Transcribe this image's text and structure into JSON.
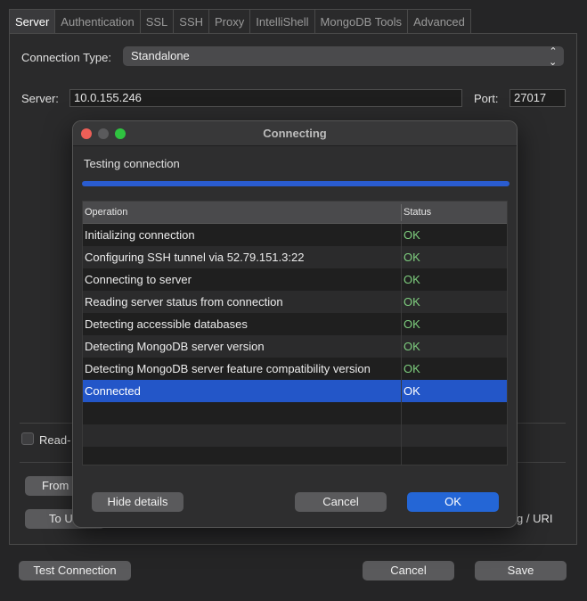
{
  "tabs": [
    {
      "label": "Server",
      "active": true
    },
    {
      "label": "Authentication"
    },
    {
      "label": "SSL"
    },
    {
      "label": "SSH"
    },
    {
      "label": "Proxy"
    },
    {
      "label": "IntelliShell"
    },
    {
      "label": "MongoDB Tools"
    },
    {
      "label": "Advanced"
    }
  ],
  "form": {
    "connection_type_label": "Connection Type:",
    "connection_type_value": "Standalone",
    "server_label": "Server:",
    "server_value": "10.0.155.246",
    "port_label": "Port:",
    "port_value": "27017",
    "readonly_label_partial": "Read-",
    "from_button_partial": "From",
    "to_button_partial": "To U",
    "uri_partial": "g / URI"
  },
  "footer": {
    "test_connection": "Test Connection",
    "cancel": "Cancel",
    "save": "Save"
  },
  "dialog": {
    "title": "Connecting",
    "status_text": "Testing connection",
    "progress": 1.0,
    "columns": {
      "operation": "Operation",
      "status": "Status"
    },
    "rows": [
      {
        "operation": "Initializing connection",
        "status": "OK"
      },
      {
        "operation": "Configuring SSH tunnel via 52.79.151.3:22",
        "status": "OK"
      },
      {
        "operation": "Connecting to server",
        "status": "OK"
      },
      {
        "operation": "Reading server status from connection",
        "status": "OK"
      },
      {
        "operation": "Detecting accessible databases",
        "status": "OK"
      },
      {
        "operation": "Detecting MongoDB server version",
        "status": "OK"
      },
      {
        "operation": "Detecting MongoDB server feature compatibility version",
        "status": "OK"
      },
      {
        "operation": "Connected",
        "status": "OK",
        "selected": true
      }
    ],
    "hide_details": "Hide details",
    "cancel": "Cancel",
    "ok": "OK"
  },
  "colors": {
    "accent": "#2466d6",
    "selection": "#2356c8",
    "ok_green": "#7fcf7f",
    "close_light": "#ed5f57",
    "inactive_light": "#5a5a5c",
    "zoom_light": "#2fc340"
  }
}
